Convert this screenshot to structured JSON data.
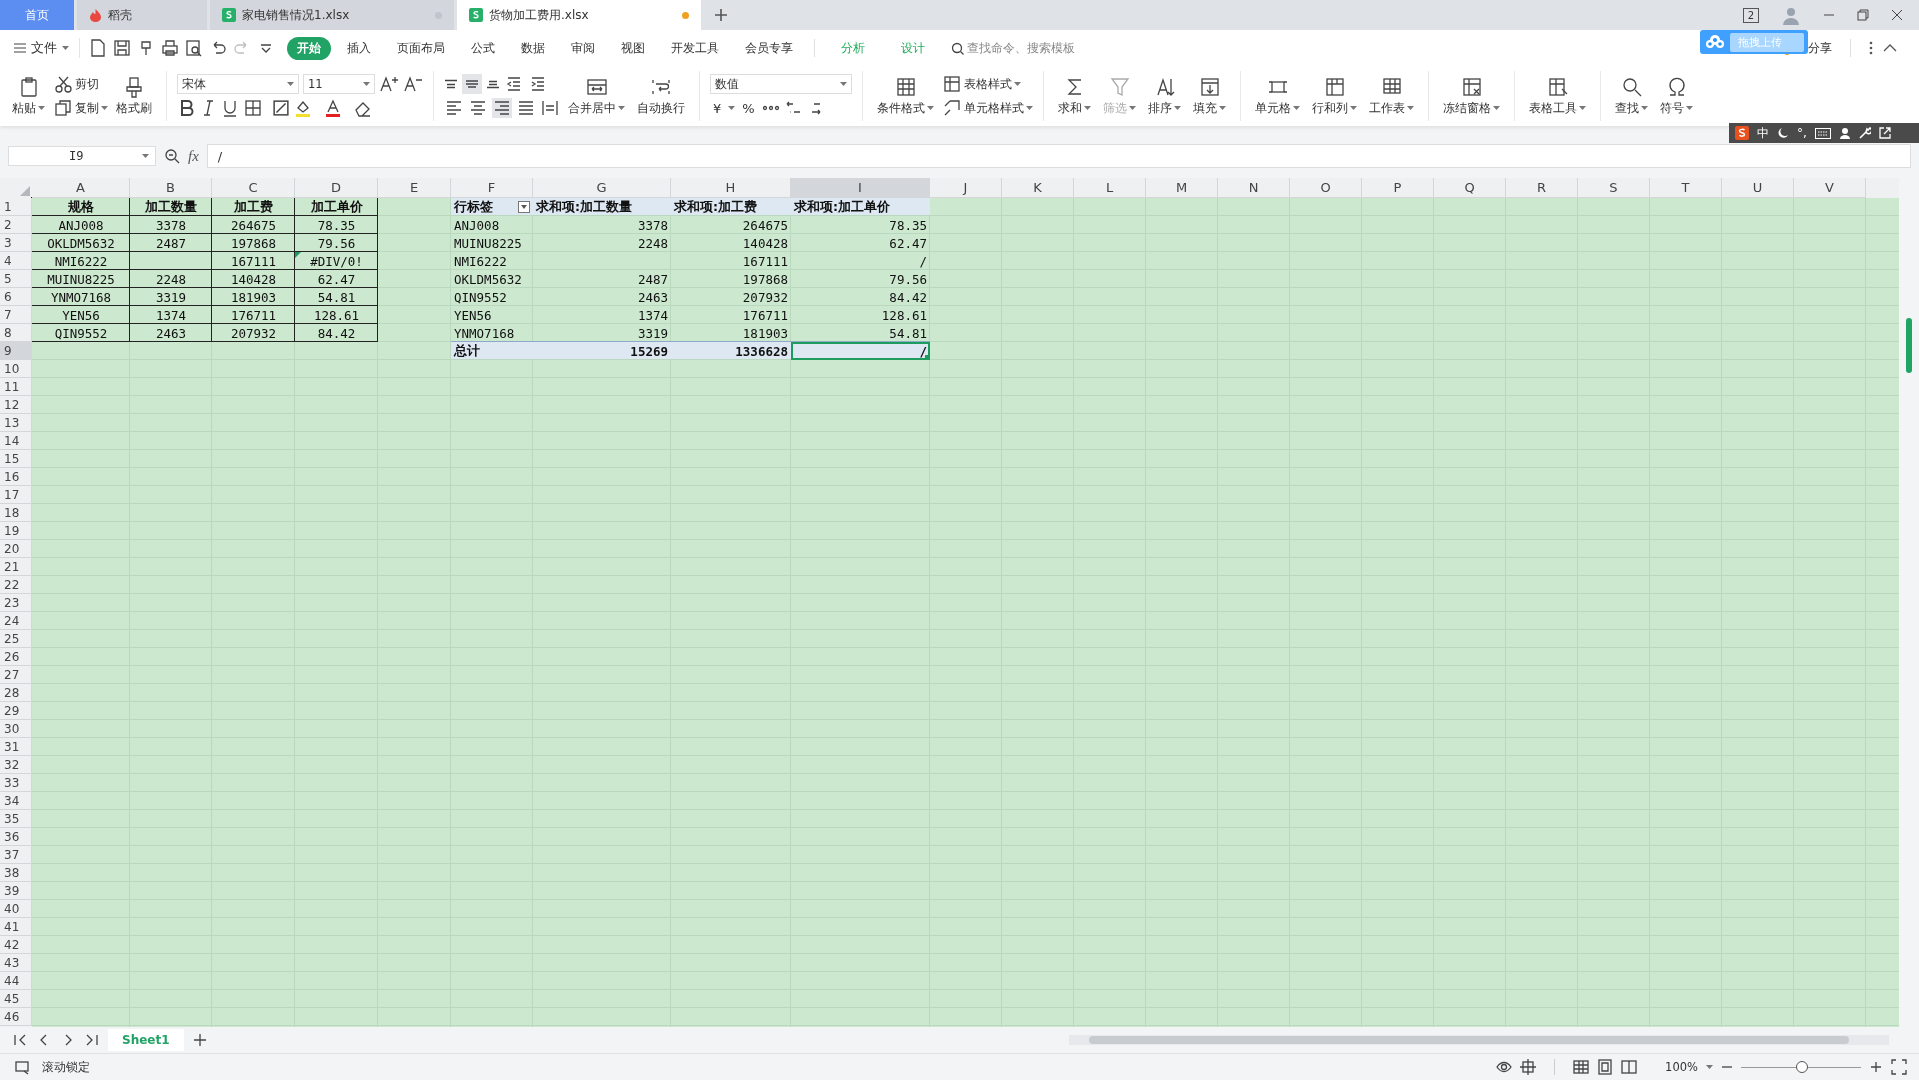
{
  "tabs": [
    {
      "label": "首页",
      "kind": "home",
      "selected": false
    },
    {
      "label": "稻壳",
      "kind": "docer",
      "selected": false
    },
    {
      "label": "家电销售情况1.xlsx",
      "kind": "sheet",
      "selected": false,
      "modified": false
    },
    {
      "label": "货物加工费用.xlsx",
      "kind": "sheet",
      "selected": true,
      "modified": true
    }
  ],
  "window_count": "2",
  "upload_popup": "拖拽上传",
  "file_menu": "文件",
  "menu": [
    {
      "label": "开始",
      "kind": "main",
      "selected": true
    },
    {
      "label": "插入",
      "kind": "main",
      "selected": false
    },
    {
      "label": "页面布局",
      "kind": "main",
      "selected": false
    },
    {
      "label": "公式",
      "kind": "main",
      "selected": false
    },
    {
      "label": "数据",
      "kind": "main",
      "selected": false
    },
    {
      "label": "审阅",
      "kind": "main",
      "selected": false
    },
    {
      "label": "视图",
      "kind": "main",
      "selected": false
    },
    {
      "label": "开发工具",
      "kind": "main",
      "selected": false
    },
    {
      "label": "会员专享",
      "kind": "main",
      "selected": false
    },
    {
      "label": "分析",
      "kind": "context",
      "selected": false
    },
    {
      "label": "设计",
      "kind": "context",
      "selected": false
    }
  ],
  "search": {
    "placeholder": "查找命令、搜索模板"
  },
  "share": "分享",
  "ribbon": [
    {
      "kind": "large",
      "label": "粘贴",
      "dropdown": true,
      "disabled": false
    },
    {
      "kind": "stack",
      "items": [
        {
          "label": "剪切",
          "dropdown": false
        },
        {
          "label": "复制",
          "dropdown": true
        }
      ]
    },
    {
      "kind": "large",
      "label": "格式刷",
      "dropdown": false,
      "disabled": false
    },
    {
      "kind": "separator"
    },
    {
      "kind": "font",
      "font": "宋体",
      "size": "11"
    },
    {
      "kind": "separator"
    },
    {
      "kind": "align"
    },
    {
      "kind": "large",
      "label": "合并居中",
      "dropdown": true,
      "disabled": false
    },
    {
      "kind": "large",
      "label": "自动换行",
      "dropdown": false,
      "disabled": false
    },
    {
      "kind": "separator"
    },
    {
      "kind": "number",
      "format": "数值",
      "currency": "¥",
      "percent": "%"
    },
    {
      "kind": "separator"
    },
    {
      "kind": "large",
      "label": "条件格式",
      "dropdown": true,
      "disabled": false
    },
    {
      "kind": "stack",
      "items": [
        {
          "label": "表格样式",
          "dropdown": true
        },
        {
          "label": "单元格样式",
          "dropdown": true
        }
      ]
    },
    {
      "kind": "separator"
    },
    {
      "kind": "large",
      "label": "求和",
      "dropdown": true,
      "disabled": false
    },
    {
      "kind": "large",
      "label": "筛选",
      "dropdown": true,
      "disabled": true
    },
    {
      "kind": "large",
      "label": "排序",
      "dropdown": true,
      "disabled": false
    },
    {
      "kind": "large",
      "label": "填充",
      "dropdown": true,
      "disabled": false
    },
    {
      "kind": "separator"
    },
    {
      "kind": "large",
      "label": "单元格",
      "dropdown": true,
      "disabled": false
    },
    {
      "kind": "large",
      "label": "行和列",
      "dropdown": true,
      "disabled": false
    },
    {
      "kind": "large",
      "label": "工作表",
      "dropdown": true,
      "disabled": false
    },
    {
      "kind": "separator"
    },
    {
      "kind": "large",
      "label": "冻结窗格",
      "dropdown": true,
      "disabled": false
    },
    {
      "kind": "separator"
    },
    {
      "kind": "large",
      "label": "表格工具",
      "dropdown": true,
      "disabled": false
    },
    {
      "kind": "separator"
    },
    {
      "kind": "large",
      "label": "查找",
      "dropdown": true,
      "disabled": false
    },
    {
      "kind": "large",
      "label": "符号",
      "dropdown": true,
      "disabled": false
    }
  ],
  "ime_bar": {
    "mode": "中",
    "punct": "°,"
  },
  "formula_bar": {
    "name_box": "I9",
    "fx": "fx",
    "value": "/"
  },
  "columns": [
    {
      "label": "A",
      "selected": false
    },
    {
      "label": "B",
      "selected": false
    },
    {
      "label": "C",
      "selected": false
    },
    {
      "label": "D",
      "selected": false
    },
    {
      "label": "E",
      "selected": false
    },
    {
      "label": "F",
      "selected": false
    },
    {
      "label": "G",
      "selected": false
    },
    {
      "label": "H",
      "selected": false
    },
    {
      "label": "I",
      "selected": true
    },
    {
      "label": "J",
      "selected": false
    },
    {
      "label": "K",
      "selected": false
    },
    {
      "label": "L",
      "selected": false
    },
    {
      "label": "M",
      "selected": false
    },
    {
      "label": "N",
      "selected": false
    },
    {
      "label": "O",
      "selected": false
    },
    {
      "label": "P",
      "selected": false
    },
    {
      "label": "Q",
      "selected": false
    },
    {
      "label": "R",
      "selected": false
    },
    {
      "label": "S",
      "selected": false
    },
    {
      "label": "T",
      "selected": false
    },
    {
      "label": "U",
      "selected": false
    },
    {
      "label": "V",
      "selected": false
    }
  ],
  "rows": [
    {
      "label": "1",
      "selected": false
    },
    {
      "label": "2",
      "selected": false
    },
    {
      "label": "3",
      "selected": false
    },
    {
      "label": "4",
      "selected": false
    },
    {
      "label": "5",
      "selected": false
    },
    {
      "label": "6",
      "selected": false
    },
    {
      "label": "7",
      "selected": false
    },
    {
      "label": "8",
      "selected": false
    },
    {
      "label": "9",
      "selected": true
    },
    {
      "label": "10",
      "selected": false
    },
    {
      "label": "11",
      "selected": false
    },
    {
      "label": "12",
      "selected": false
    },
    {
      "label": "13",
      "selected": false
    },
    {
      "label": "14",
      "selected": false
    },
    {
      "label": "15",
      "selected": false
    },
    {
      "label": "16",
      "selected": false
    },
    {
      "label": "17",
      "selected": false
    },
    {
      "label": "18",
      "selected": false
    },
    {
      "label": "19",
      "selected": false
    },
    {
      "label": "20",
      "selected": false
    },
    {
      "label": "21",
      "selected": false
    },
    {
      "label": "22",
      "selected": false
    },
    {
      "label": "23",
      "selected": false
    },
    {
      "label": "24",
      "selected": false
    },
    {
      "label": "25",
      "selected": false
    },
    {
      "label": "26",
      "selected": false
    },
    {
      "label": "27",
      "selected": false
    },
    {
      "label": "28",
      "selected": false
    },
    {
      "label": "29",
      "selected": false
    },
    {
      "label": "30",
      "selected": false
    },
    {
      "label": "31",
      "selected": false
    },
    {
      "label": "32",
      "selected": false
    },
    {
      "label": "33",
      "selected": false
    },
    {
      "label": "34",
      "selected": false
    },
    {
      "label": "35",
      "selected": false
    },
    {
      "label": "36",
      "selected": false
    },
    {
      "label": "37",
      "selected": false
    },
    {
      "label": "38",
      "selected": false
    },
    {
      "label": "39",
      "selected": false
    },
    {
      "label": "40",
      "selected": false
    },
    {
      "label": "41",
      "selected": false
    },
    {
      "label": "42",
      "selected": false
    },
    {
      "label": "43",
      "selected": false
    },
    {
      "label": "44",
      "selected": false
    },
    {
      "label": "45",
      "selected": false
    },
    {
      "label": "46",
      "selected": false
    }
  ],
  "source_table": {
    "header": [
      "规格",
      "加工数量",
      "加工费",
      "加工单价"
    ],
    "rows": [
      {
        "cells": [
          "ANJ008",
          "3378",
          "264675",
          "78.35"
        ],
        "flagged": false
      },
      {
        "cells": [
          "OKLDM5632",
          "2487",
          "197868",
          "79.56"
        ],
        "flagged": false
      },
      {
        "cells": [
          "NMI6222",
          null,
          "167111",
          "#DIV/0!"
        ],
        "flagged": true
      },
      {
        "cells": [
          "MUINU8225",
          "2248",
          "140428",
          "62.47"
        ],
        "flagged": false
      },
      {
        "cells": [
          "YNMO7168",
          "3319",
          "181903",
          "54.81"
        ],
        "flagged": false
      },
      {
        "cells": [
          "YEN56",
          "1374",
          "176711",
          "128.61"
        ],
        "flagged": false
      },
      {
        "cells": [
          "QIN9552",
          "2463",
          "207932",
          "84.42"
        ],
        "flagged": false
      }
    ]
  },
  "pivot_table": {
    "header": [
      "行标签",
      "求和项:加工数量",
      "求和项:加工费",
      "求和项:加工单价"
    ],
    "rows": [
      [
        "ANJ008",
        "3378",
        "264675",
        "78.35"
      ],
      [
        "MUINU8225",
        "2248",
        "140428",
        "62.47"
      ],
      [
        "NMI6222",
        null,
        "167111",
        "/"
      ],
      [
        "OKLDM5632",
        "2487",
        "197868",
        "79.56"
      ],
      [
        "QIN9552",
        "2463",
        "207932",
        "84.42"
      ],
      [
        "YEN56",
        "1374",
        "176711",
        "128.61"
      ],
      [
        "YNMO7168",
        "3319",
        "181903",
        "54.81"
      ]
    ],
    "total": [
      "总计",
      "15269",
      "1336628",
      "/"
    ]
  },
  "sheets": [
    {
      "label": "Sheet1",
      "selected": true
    }
  ],
  "status_bar": {
    "text": "滚动锁定",
    "zoom": "100%",
    "zoom_level": {
      "level": 0.5
    }
  }
}
